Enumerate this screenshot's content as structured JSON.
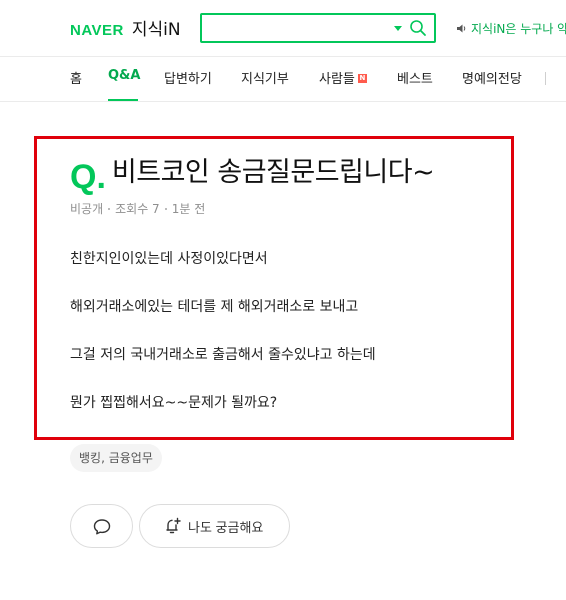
{
  "header": {
    "logo_brand": "NAVER",
    "logo_service": "지식iN",
    "search": {
      "value": "",
      "placeholder": ""
    },
    "notice": "지식iN은 누구나 약"
  },
  "nav": {
    "items": [
      {
        "label": "홈"
      },
      {
        "label": "Q&A",
        "active": true
      },
      {
        "label": "답변하기"
      },
      {
        "label": "지식기부"
      },
      {
        "label": "사람들",
        "badge": "N"
      },
      {
        "label": "베스트"
      },
      {
        "label": "명예의전당"
      }
    ]
  },
  "question": {
    "mark": "Q.",
    "title": "비트코인 송금질문드립니다~",
    "meta": {
      "visibility": "비공개",
      "views": "조회수 7",
      "time": "1분 전"
    },
    "body": [
      "친한지인이있는데 사정이있다면서",
      "해외거래소에있는 테더를 제 해외거래소로 보내고",
      "그걸 저의 국내거래소로 출금해서 줄수있냐고 하는데",
      "뭔가 찝찝해서요~~문제가 될까요?"
    ],
    "tag": "뱅킹, 금융업무"
  },
  "actions": {
    "curious_label": "나도 궁금해요"
  },
  "colors": {
    "brand_green": "#03c75a",
    "highlight_red": "#e0000b",
    "new_badge": "#ff5b4d"
  },
  "icons": [
    "search-icon",
    "speaker-icon",
    "comment-icon",
    "bell-plus-icon"
  ]
}
